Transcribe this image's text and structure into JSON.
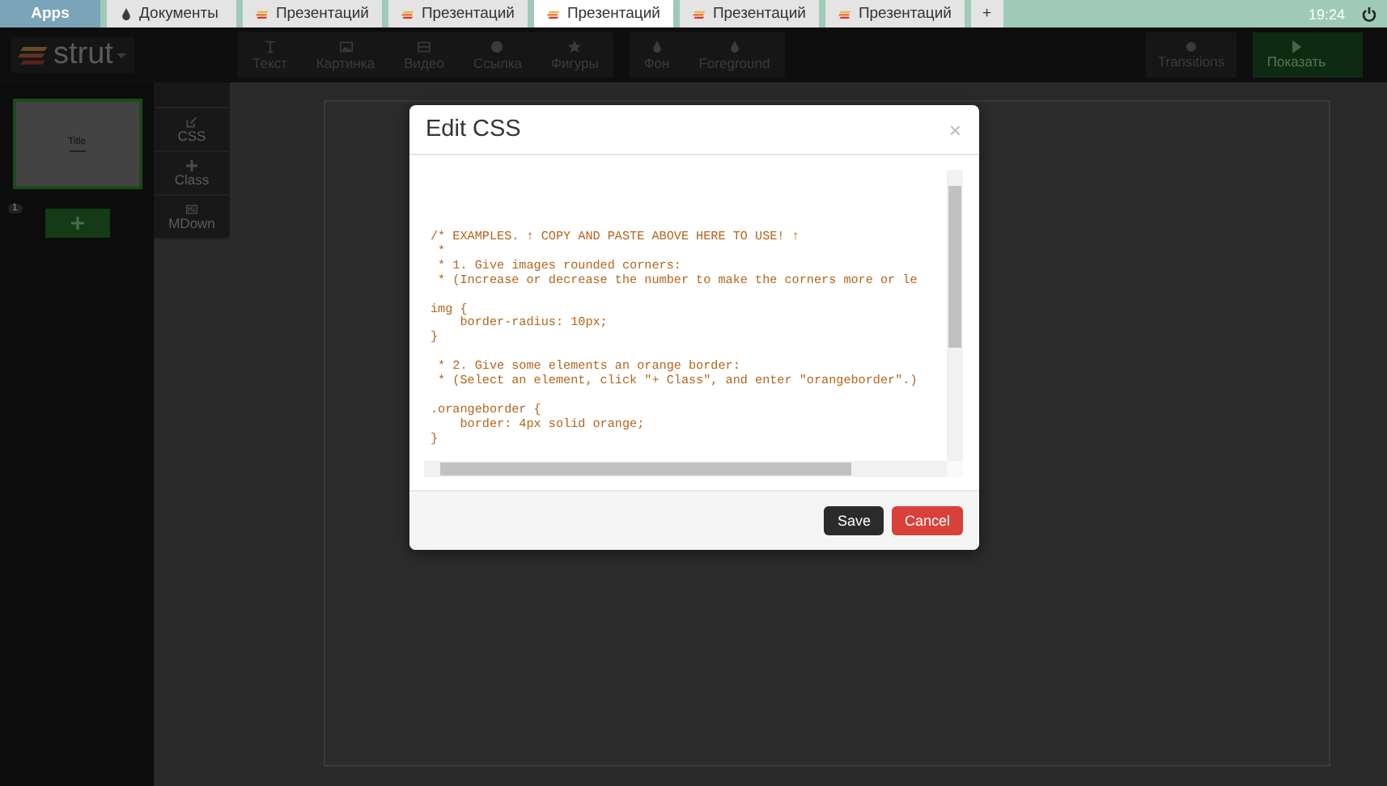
{
  "browser_tabs": [
    {
      "label": "Apps",
      "kind": "apps",
      "selected": false
    },
    {
      "label": "Документы",
      "kind": "docs",
      "selected": false
    },
    {
      "label": "Презентаций",
      "kind": "strut",
      "selected": false
    },
    {
      "label": "Презентаций",
      "kind": "strut",
      "selected": false
    },
    {
      "label": "Презентаций",
      "kind": "strut",
      "selected": true
    },
    {
      "label": "Презентаций",
      "kind": "strut",
      "selected": false
    },
    {
      "label": "Презентаций",
      "kind": "strut",
      "selected": false
    },
    {
      "label": "+",
      "kind": "new",
      "selected": false
    }
  ],
  "clock": "19:24",
  "logo": "strut",
  "toolbar": [
    {
      "label": "Текст"
    },
    {
      "label": "Картинка"
    },
    {
      "label": "Видео"
    },
    {
      "label": "Ссылка"
    },
    {
      "label": "Фигуры"
    }
  ],
  "toolbar_2": [
    {
      "label": "Фон"
    },
    {
      "label": "Foreground"
    }
  ],
  "transitions_button": "Transitions",
  "present_button": "Показать",
  "slides": [
    {
      "number": "1",
      "title": "Title",
      "selected": true
    }
  ],
  "side_tools": [
    {
      "label": "CSS"
    },
    {
      "label": "Class"
    },
    {
      "label": "MDown"
    }
  ],
  "dialog": {
    "title": "Edit CSS",
    "close": "×",
    "code": "/* EXAMPLES. ↑ COPY AND PASTE ABOVE HERE TO USE! ↑\n *\n * 1. Give images rounded corners:\n * (Increase or decrease the number to make the corners more or le\n\nimg {\n    border-radius: 10px;\n}\n\n * 2. Give some elements an orange border:\n * (Select an element, click \"+ Class\", and enter \"orangeborder\".)\n\n.orangeborder {\n    border: 4px solid orange;\n}",
    "buttons": [
      {
        "label": "Save",
        "kind": "primary"
      },
      {
        "label": "Cancel",
        "kind": "danger"
      }
    ]
  }
}
